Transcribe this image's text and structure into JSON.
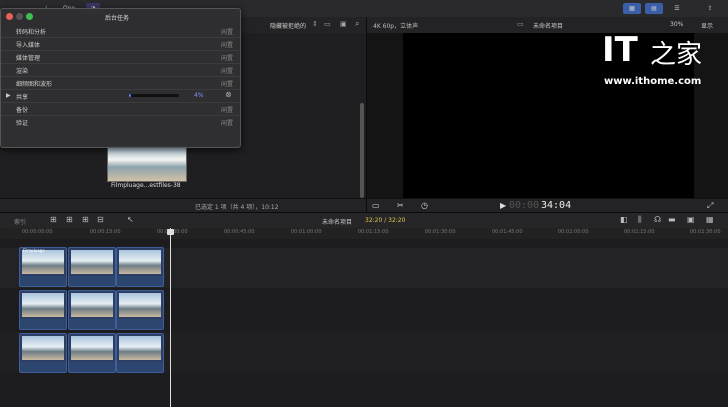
{
  "topbar": {
    "label_one": "One"
  },
  "browser_header": {
    "filter_label": "隐藏被拒绝的"
  },
  "viewer_header": {
    "format": "4K 60p，立体声",
    "project_name": "未命名项目",
    "zoom": "30%",
    "view_label": "显示"
  },
  "browser": {
    "clip_name": "Filmpluage...estfiles-38",
    "status": "已选定 1 项（共 4 项），10:12"
  },
  "viewer_controls": {
    "timecode_dim": "00:00",
    "timecode": "34:04"
  },
  "timeline_toolbar": {
    "index_label": "索引",
    "project_name": "未命名项目",
    "duration": "32:20 / 32:20"
  },
  "ruler": {
    "ticks": [
      "00:00:00:00",
      "00:00:15:00",
      "00:00:30:00",
      "00:00:45:00",
      "00:01:00:00",
      "00:01:15:00",
      "00:01:30:00",
      "00:01:45:00",
      "00:02:00:00",
      "00:02:15:00",
      "00:02:30:00"
    ]
  },
  "clips": {
    "title": "Filmpluage"
  },
  "background_tasks": {
    "title": "后台任务",
    "rows": [
      {
        "label": "转码和分析",
        "state": "闲置"
      },
      {
        "label": "导入媒体",
        "state": "闲置"
      },
      {
        "label": "媒体管理",
        "state": "闲置"
      },
      {
        "label": "渲染",
        "state": "闲置"
      },
      {
        "label": "细频图和波形",
        "state": "闲置"
      },
      {
        "label": "共享",
        "state": "",
        "progress": 4,
        "progress_label": "4%"
      },
      {
        "label": "备份",
        "state": "闲置"
      },
      {
        "label": "验证",
        "state": "闲置"
      }
    ]
  },
  "watermark": {
    "brand_letters": "IT",
    "brand_char": "之家",
    "url": "www.ithome.com"
  },
  "colors": {
    "accent": "#3a5fa8",
    "clip_border": "#3e5f9a",
    "progress": "#5a7cf0",
    "timecode_yellow": "#e0c94a"
  }
}
